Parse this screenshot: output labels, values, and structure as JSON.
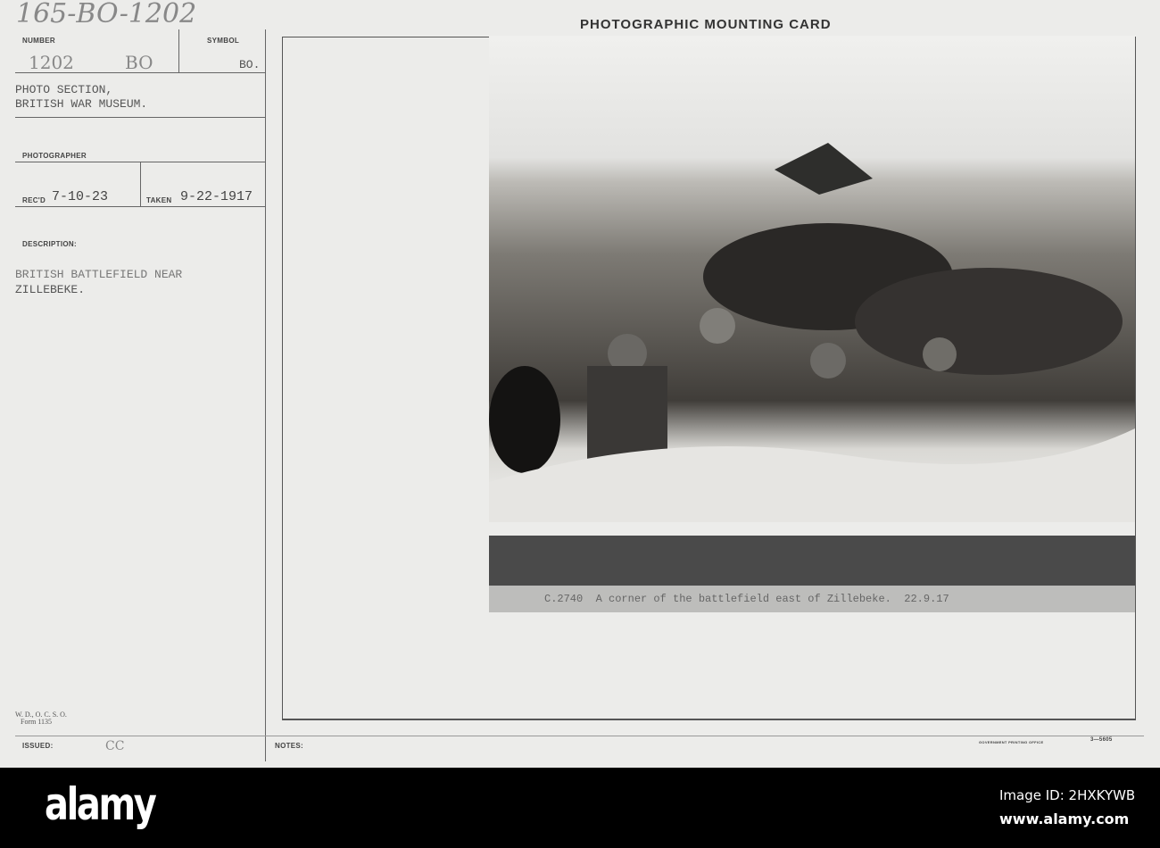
{
  "card": {
    "handwritten_id": "165-BO-1202",
    "header_title": "Photographic Mounting Card",
    "number_label": "NUMBER",
    "number_value": "1202",
    "number_hand_symbol": "BO",
    "symbol_label": "SYMBOL",
    "symbol_value": "BO.",
    "source": [
      "PHOTO SECTION,",
      "BRITISH WAR MUSEUM."
    ],
    "photographer_label": "PHOTOGRAPHER",
    "recd_label": "REC'D",
    "recd_value": "7-10-23",
    "taken_label": "TAKEN",
    "taken_value": "9-22-1917",
    "description_label": "DESCRIPTION:",
    "description": [
      "BRITISH BATTLEFIELD NEAR",
      "ZILLEBEKE."
    ],
    "form_line1": "W. D., O. C. S. O.",
    "form_line2": "Form 1135",
    "issued_label": "ISSUED:",
    "issued_value": "CC",
    "notes_label": "NOTES:",
    "printing_office": "GOVERNMENT PRINTING OFFICE",
    "form_code": "3—5605",
    "photo_caption": "C.2740  A corner of the battlefield east of Zillebeke.  22.9.17"
  },
  "footer": {
    "logo": "alamy",
    "image_id": "Image ID: 2HXKYWB",
    "url": "www.alamy.com"
  }
}
